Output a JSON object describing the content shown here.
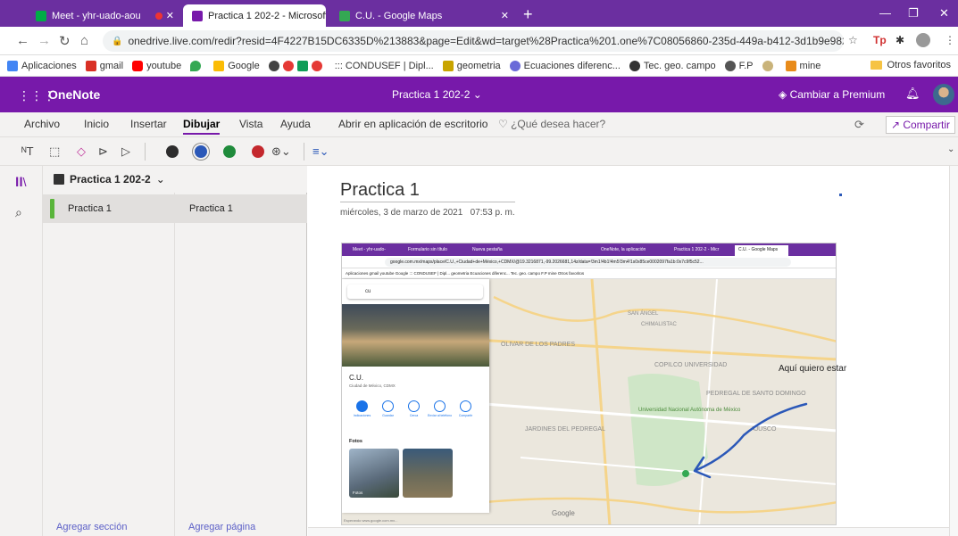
{
  "browser": {
    "tabs": [
      {
        "title": "Meet - yhr-uado-aou",
        "active": false
      },
      {
        "title": "Practica 1 202-2 - Microsoft One",
        "active": true
      },
      {
        "title": "C.U. - Google Maps",
        "active": false
      }
    ],
    "url": "onedrive.live.com/redir?resid=4F4227B15DC6335D%213883&page=Edit&wd=target%28Practica%201.one%7C08056860-235d-449a-b412-3d1b9e98204d%2FPág...",
    "bookmarks": [
      "Aplicaciones",
      "gmail",
      "youtube",
      "Google",
      "::: CONDUSEF | Dipl...",
      "geometria",
      "Ecuaciones diferenc...",
      "Tec. geo. campo",
      "F.P",
      "mine"
    ],
    "other_bookmarks": "Otros favoritos"
  },
  "onenote": {
    "app_name": "OneNote",
    "doc_title": "Practica 1 202-2 ⌄",
    "premium": "Cambiar a Premium",
    "ribbon_tabs": [
      "Archivo",
      "Inicio",
      "Insertar",
      "Dibujar",
      "Vista",
      "Ayuda"
    ],
    "active_tab": "Dibujar",
    "open_desktop": "Abrir en aplicación de escritorio",
    "tell_me": "¿Qué desea hacer?",
    "share": "Compartir",
    "pen_colors": [
      "#2d2d2d",
      "#2b58b8",
      "#1f8b3b",
      "#c4282d"
    ],
    "accent": "#7719aa"
  },
  "sidebar": {
    "notebook": "Practica 1 202-2",
    "section": "Practica 1",
    "page": "Practica 1",
    "add_section": "Agregar sección",
    "add_page": "Agregar página"
  },
  "page": {
    "title": "Practica 1",
    "date": "miércoles, 3 de marzo de 2021",
    "time": "07:53 p. m.",
    "annotation": "Aquí quiero estar"
  },
  "embedded": {
    "tabs": [
      "Meet - yhr-uado-",
      "Formulario sin título",
      "Nueva pestaña",
      "OneNote, la aplicación",
      "Practica 1 202-2 - Micr",
      "C.U. - Google Maps"
    ],
    "url": "google.com.mx/maps/place/C.U.,+Ciudad+de+México,+CDMX/@19.3216871,-99.2026681,14z/data=!3m1!4b1!4m5!3m4!1s0x85ce0002097fa1b:0x7c9f5c52...",
    "bookmarks": "Aplicaciones  gmail  youtube  Google  ::: CONDUSEF | Dipl...  geometria  Ecuaciones diferenc...  Tec. geo. campo  F.P  mine        Otros favoritos",
    "search": "cu",
    "place_name": "C.U.",
    "place_sub": "Ciudad de México, CDMX",
    "actions": [
      "Indicaciones",
      "Guardar",
      "Cerca",
      "Enviar al teléfono",
      "Compartir"
    ],
    "photos_label": "Fotos",
    "photo_caption": "Fotos",
    "status": "Esperando www.google.com.mx...",
    "map_labels": [
      "OLIVAR DE LOS PADRES",
      "JARDINES DEL PEDREGAL",
      "COPILCO UNIVERSIDAD",
      "PEDREGAL DE SANTO DOMINGO",
      "AJUSCO",
      "Universidad Nacional Autónoma de México",
      "SAN ÁNGEL",
      "CHIMALISTAC",
      "Google"
    ]
  }
}
